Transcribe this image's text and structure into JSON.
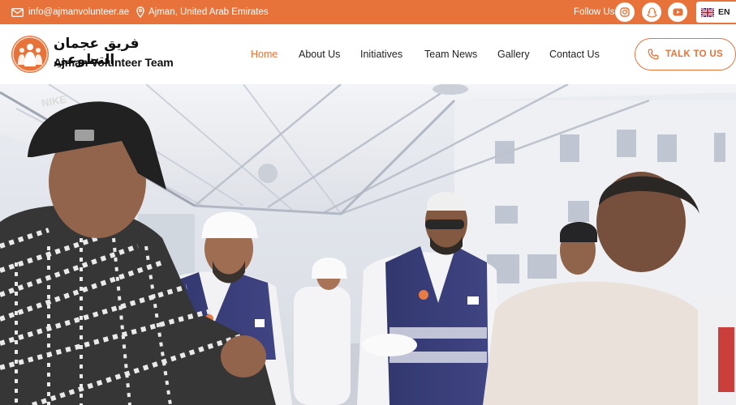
{
  "topbar": {
    "email": "info@ajmanvolunteer.ae",
    "location": "Ajman, United Arab Emirates",
    "follow_label": "Follow Us",
    "social": [
      {
        "icon": "instagram-icon"
      },
      {
        "icon": "snapchat-icon"
      },
      {
        "icon": "youtube-icon"
      }
    ],
    "language": {
      "code": "EN",
      "icon": "uk-flag-icon"
    }
  },
  "header": {
    "logo": {
      "name_ar": "فريق عجمان التطوعي",
      "name_en": "Ajman Volunteer Team",
      "icon": "volunteers-logo-icon"
    },
    "nav": [
      {
        "label": "Home",
        "active": true
      },
      {
        "label": "About Us",
        "active": false
      },
      {
        "label": "Initiatives",
        "active": false
      },
      {
        "label": "Team News",
        "active": false
      },
      {
        "label": "Gallery",
        "active": false
      },
      {
        "label": "Contact Us",
        "active": false
      }
    ],
    "cta": {
      "label": "TALK TO US",
      "icon": "phone-icon"
    }
  },
  "hero": {
    "cap_text": "NIKE"
  },
  "colors": {
    "accent": "#e8733a",
    "text": "#222222",
    "vest": "#2a2f6e"
  }
}
